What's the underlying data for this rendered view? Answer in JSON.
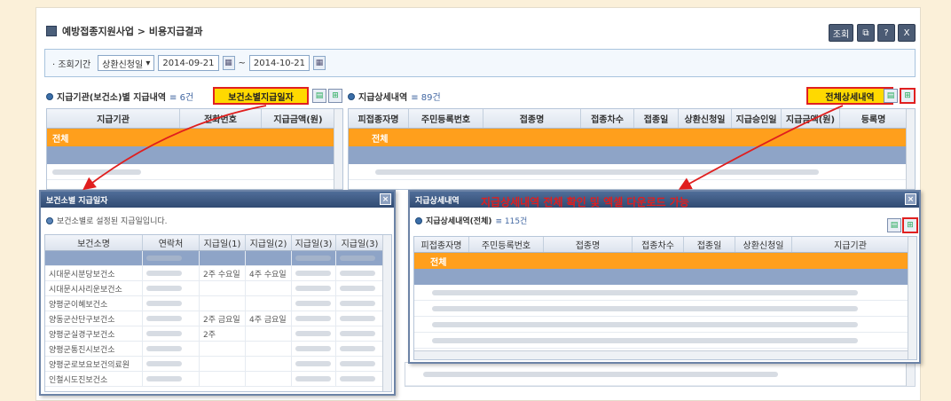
{
  "breadcrumb": "예방접종지원사업 > 비용지급결과",
  "toolbar": {
    "search": "조회",
    "help": "?",
    "close": "X"
  },
  "filter": {
    "label": "· 조회기간",
    "type": "상환신청일",
    "from": "2014-09-21",
    "to": "2014-10-21",
    "sep": "~"
  },
  "left_section": {
    "title": "지급기관(보건소)별 지급내역",
    "count": "≡ 6건",
    "button": "보건소별지급일자",
    "columns": [
      "지급기관",
      "전화번호",
      "지급금액(원)"
    ],
    "total": "전체"
  },
  "right_section": {
    "title": "지급상세내역",
    "count": "≡ 89건",
    "button": "전체상세내역",
    "columns": [
      "피접종자명",
      "주민등록번호",
      "접종명",
      "접종차수",
      "접종일",
      "상환신청일",
      "지급승인일",
      "지급금액(원)",
      "등록명"
    ],
    "total": "전체"
  },
  "popup1": {
    "title": "보건소별 지급일자",
    "info": "보건소별로 설정된 지급일입니다.",
    "columns": [
      "보건소명",
      "연락처",
      "지급일(1)",
      "지급일(2)",
      "지급일(3)",
      "지급일(3)"
    ],
    "rows": [
      {
        "name": "",
        "d1": "",
        "d2": ""
      },
      {
        "name": "시대문시분당보건소",
        "d1": "2주 수요일",
        "d2": "4주 수요일"
      },
      {
        "name": "시대문시사리운보건소",
        "d1": "",
        "d2": ""
      },
      {
        "name": "양평군이혜보건소",
        "d1": "",
        "d2": ""
      },
      {
        "name": "양동군산단구보건소",
        "d1": "2주 금요일",
        "d2": "4주 금요일"
      },
      {
        "name": "양평군실경구보건소",
        "d1": "2주",
        "d2": ""
      },
      {
        "name": "양평군통진시보건소",
        "d1": "",
        "d2": ""
      },
      {
        "name": "양평군로보요보건의료원",
        "d1": "",
        "d2": ""
      },
      {
        "name": "인철시도진보건소",
        "d1": "",
        "d2": ""
      }
    ]
  },
  "popup2": {
    "title": "지급상세내역",
    "subtitle": "지급상세내역(전체)",
    "count": "≡ 115건",
    "total": "전체",
    "columns": [
      "피접종자명",
      "주민등록번호",
      "접종명",
      "접종차수",
      "접종일",
      "상환신청일",
      "지급기관"
    ]
  },
  "annotation": "지급상세내역 전체 확인 및 엑셀 다운로드 가능",
  "colors": {
    "highlight": "#ff9f1c",
    "selected": "#8ea4c7",
    "annotation": "#e01e1e",
    "button": "#ffd900"
  }
}
